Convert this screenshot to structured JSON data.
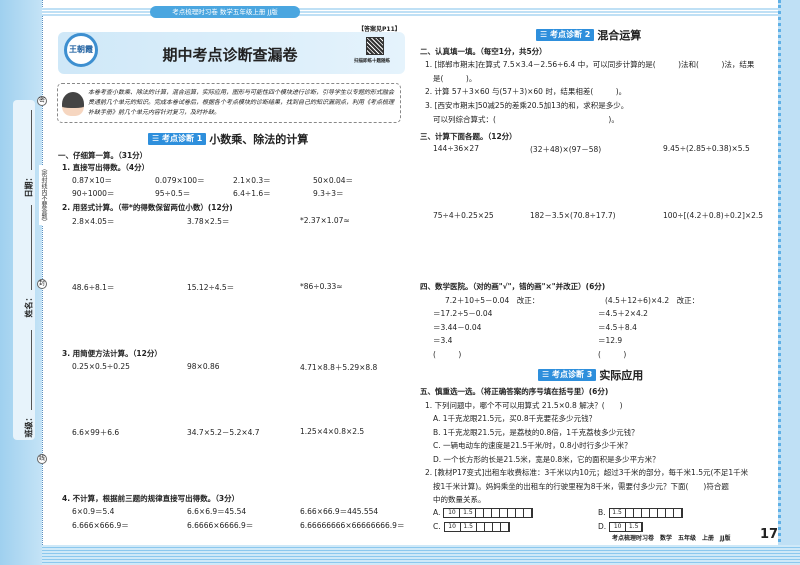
{
  "binding": {
    "date": "日期：",
    "name": "姓名：",
    "class": "班级：",
    "note": "（密封线内不要答题）",
    "marks": [
      "密",
      "封",
      "线"
    ]
  },
  "banner": "考点梳理时习卷 数学五年级上册 JJ版",
  "answer_ref": "【答案见P11】",
  "logo_text": "王朝霞",
  "title": "期中考点诊断查漏卷",
  "qr_caption": "扫描即练十题随练",
  "intro": "本卷考查小数乘、除法的计算，混合运算，实际应用，图形与可能性四个模块进行诊断，引导学生以专题的形式融会贯通前几个单元的知识。完成本卷试卷后，根据各个考点模块的诊断结果，找到自己的知识漏洞点，利用《考点梳理补缺手册》前几个单元内容针对复习，及时补缺。",
  "sec1": {
    "tag": "☰ 考点诊断 1",
    "title": "小数乘、除法的计算"
  },
  "part1": {
    "heading": "一、仔细算一算。（31分）",
    "q1": {
      "label": "1. 直接写出得数。（4分）",
      "items": [
        "0.87×10＝",
        "0.079×100＝",
        "2.1×0.3＝",
        "50×0.04＝",
        "90÷1000＝",
        "95÷0.5＝",
        "6.4÷1.6＝",
        "9.3÷3＝"
      ]
    },
    "q2": {
      "label": "2. 用竖式计算。（带*的得数保留两位小数）(12分)",
      "items": [
        "2.8×4.05＝",
        "3.78×2.5＝",
        "*2.37×1.07≈",
        "48.6÷8.1＝",
        "15.12÷4.5＝",
        "*86÷0.33≈"
      ]
    },
    "q3": {
      "label": "3. 用简便方法计算。（12分）",
      "items": [
        "0.25×0.5÷0.25",
        "98×0.86",
        "4.71×8.8＋5.29×8.8",
        "6.6×99＋6.6",
        "34.7×5.2－5.2×4.7",
        "1.25×4×0.8×2.5"
      ]
    },
    "q4": {
      "label": "4. 不计算，根据前三题的规律直接写出得数。（3分）",
      "items": [
        "6×0.9＝5.4",
        "6.6×6.9＝45.54",
        "6.66×66.9＝445.554",
        "6.666×666.9＝",
        "6.6666×6666.9＝",
        "6.66666666×66666666.9＝"
      ]
    }
  },
  "sec2": {
    "tag": "☰ 考点诊断 2",
    "title": "混合运算"
  },
  "part2": {
    "heading": "二、认真填一填。（每空1分，共5分）",
    "lines": [
      "1. [邯郸市期末]在算式 7.5×3.4－2.56÷6.4 中，可以同步计算的是(　　　)法和(　　　)法，结果",
      "是(　　　)。",
      "2. 计算 57＋3×60 与(57＋3)×60 时，结果相差(　　　)。",
      "3. [西安市期末]50减25的差乘20.5加13的和，求积是多少。",
      "可以列综合算式：(　　　　　　　　　　　　　　　)。"
    ]
  },
  "part3": {
    "heading": "三、计算下面各题。（12分）",
    "items": [
      "144÷36×27",
      "(32＋48)×(97－58)",
      "9.45÷(2.85÷0.38)×5.5",
      "75÷4＋0.25×25",
      "182－3.5×(70.8÷17.7)",
      "100÷[(4.2＋0.8)÷0.2]×2.5"
    ]
  },
  "part4": {
    "heading": "四、数学医院。（对的画\"√\"，错的画\"×\"并改正）(6分)",
    "left": [
      "7.2＋10÷5－0.04　改正：",
      "＝17.2÷5－0.04",
      "＝3.44－0.04",
      "＝3.4",
      "(　　　)"
    ],
    "right": [
      "(4.5＋12÷6)×4.2　改正：",
      "＝4.5＋2×4.2",
      "＝4.5＋8.4",
      "＝12.9",
      "(　　　)"
    ]
  },
  "sec3": {
    "tag": "☰ 考点诊断 3",
    "title": "实际应用"
  },
  "part5": {
    "heading": "五、慎重选一选。（将正确答案的序号填在括号里）(6分)",
    "q1": {
      "stem": "1. 下列问题中，哪个不可以用算式 21.5×0.8 解决？(　　)",
      "options": [
        "A. 1千克龙眼21.5元，买0.8千克要花多少元钱？",
        "B. 1千克龙眼21.5元，是荔枝的0.8倍，1千克荔枝多少元钱？",
        "C. 一辆电动车的速度是21.5千米/时，0.8小时行多少千米？",
        "D. 一个长方形的长是21.5米，宽是0.8米，它的面积是多少平方米？"
      ]
    },
    "q2": {
      "lines": [
        "2. [教材P17变式]出租车收费标准：3千米以内10元；超过3千米的部分，每千米1.5元(不足1千米",
        "按1千米计算)。妈妈乘坐的出租车的行驶里程为8千米，需要付多少元？下面(　　)符合题",
        "中的数量关系。"
      ],
      "options": [
        {
          "label": "A.",
          "cells": [
            "10",
            "1.5"
          ],
          "empty": 7
        },
        {
          "label": "B.",
          "cells": [
            "1.5"
          ],
          "empty": 7
        },
        {
          "label": "C.",
          "cells": [
            "10",
            "1.5"
          ],
          "empty": 4
        },
        {
          "label": "D.",
          "cells": [
            "10",
            "1.5"
          ],
          "empty": 0
        }
      ]
    }
  },
  "footer": "考点梳理时习卷　数学　五年级　上册　JJ版",
  "page_number": "17"
}
